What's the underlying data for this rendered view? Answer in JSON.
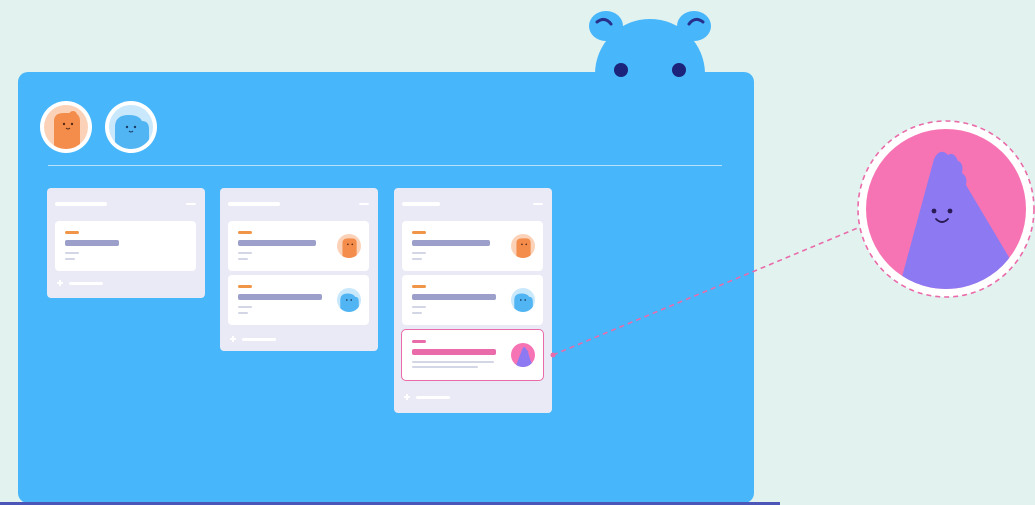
{
  "colors": {
    "background": "#e1f2ef",
    "board": "#47b6fb",
    "list": "#e9eaf5",
    "card": "#ffffff",
    "label_orange": "#f09547",
    "label_pink": "#ea6ba9",
    "title_bar": "#9b9fc9",
    "title_bar_highlight": "#ea6ba9",
    "highlight_border": "#ea6ba9",
    "orange_avatar": "#f48d4b",
    "blue_avatar": "#52b5f3",
    "purple_avatar": "#8d79f2",
    "pink_zoom": "#f774b4",
    "floor_line": "#4c55b8"
  },
  "icons": {
    "mascot": "blue-mascot-icon",
    "member_1": "orange-blob-avatar-icon",
    "member_2": "blue-blob-avatar-icon",
    "zoomed": "purple-pink-avatar-icon",
    "add": "plus-icon"
  },
  "board": {
    "members": [
      {
        "avatar": "orange"
      },
      {
        "avatar": "blue"
      }
    ],
    "lists": [
      {
        "cards": [
          {
            "has_avatar": false,
            "highlighted": false
          }
        ]
      },
      {
        "cards": [
          {
            "avatar": "orange",
            "highlighted": false
          },
          {
            "avatar": "blue",
            "highlighted": false
          }
        ]
      },
      {
        "cards": [
          {
            "avatar": "orange",
            "highlighted": false
          },
          {
            "avatar": "blue",
            "highlighted": false
          },
          {
            "avatar": "purple",
            "highlighted": true
          }
        ]
      }
    ]
  }
}
